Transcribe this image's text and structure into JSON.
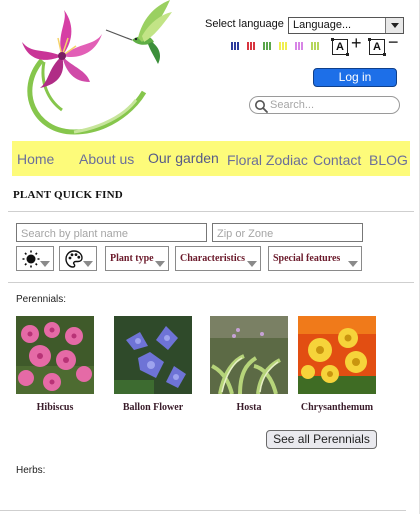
{
  "header": {
    "language_label": "Select language",
    "language_select": "Language...",
    "login_label": "Log in",
    "search_placeholder": "Search...",
    "palette_colors": [
      "#2c3a9c",
      "#d8343f",
      "#5aa64b",
      "#f0ee4f",
      "#d785e6",
      "#b6d65a"
    ],
    "font_increase": "+",
    "font_decrease": "−",
    "font_box_letter": "A"
  },
  "nav": {
    "items": [
      "Home",
      "About us",
      "Our garden",
      "Floral Zodiac",
      "Contact",
      "BLOG"
    ],
    "highlight_color": "#fdfb7a"
  },
  "quick_find": {
    "title": "PLANT QUICK FIND",
    "plant_name_placeholder": "Search by plant name",
    "zip_placeholder": "Zip or Zone",
    "filters": [
      "Plant type",
      "Characteristics",
      "Special features"
    ],
    "icon_filters": [
      "sun-icon",
      "palette-icon"
    ]
  },
  "perennials": {
    "heading": "Perennials:",
    "plants": [
      {
        "name": "Hibiscus"
      },
      {
        "name": "Ballon Flower"
      },
      {
        "name": "Hosta"
      },
      {
        "name": "Chrysanthemum"
      }
    ],
    "see_all": "See all Perennials"
  },
  "herbs": {
    "heading": "Herbs:"
  }
}
